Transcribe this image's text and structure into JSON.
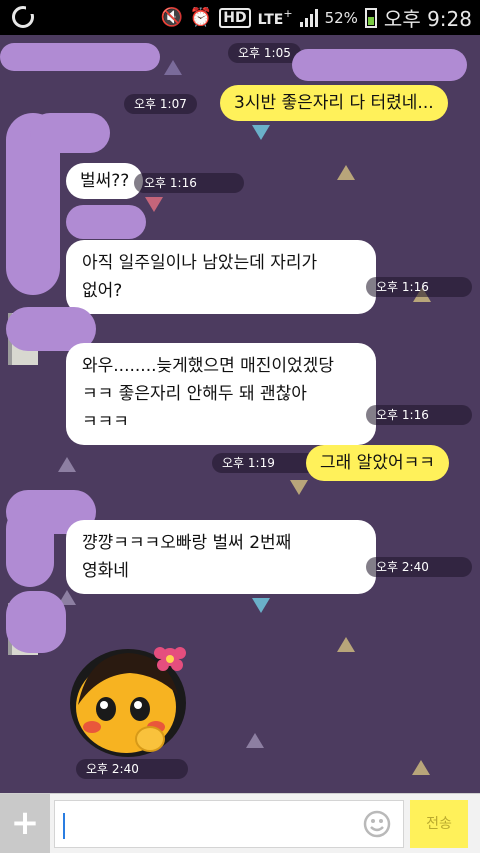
{
  "status_bar": {
    "battery": "52%",
    "lte": "LTE",
    "lte_sup": "+",
    "hd": "HD",
    "time": "오후 9:28"
  },
  "chat": {
    "header_time": "오후 1:05",
    "messages": [
      {
        "side": "out",
        "text": "3시반 좋은자리 다 터렸네...",
        "time": "오후 1:07"
      },
      {
        "side": "in",
        "text": "벌써??",
        "time": "오후 1:16"
      },
      {
        "side": "in",
        "lines": [
          "아직 일주일이나 남았는데 자리가",
          "없어?"
        ],
        "time": "오후 1:16"
      },
      {
        "side": "in",
        "lines": [
          "와우........늦게했으면 매진이었겠당",
          "ㅋㅋ 좋은자리 안해두 돼 괜찮아",
          "ㅋㅋㅋ"
        ],
        "time": "오후 1:16"
      },
      {
        "side": "out",
        "text": "그래 알았어ㅋㅋ",
        "time": "오후 1:19"
      },
      {
        "side": "in",
        "lines": [
          "꺙꺙ㅋㅋㅋ오빠랑 벌써 2번째",
          "영화네"
        ],
        "time": "오후 2:40"
      },
      {
        "side": "in",
        "type": "emoticon",
        "icon": "blushing-girl-emoticon",
        "time": "오후 2:40"
      }
    ]
  },
  "input_bar": {
    "plus_label": "+",
    "send_label": "전송"
  },
  "colors": {
    "background": "#4c3b5f",
    "incoming": "#ffffff",
    "outgoing": "#fff15a",
    "blur": "#b08bd3"
  }
}
